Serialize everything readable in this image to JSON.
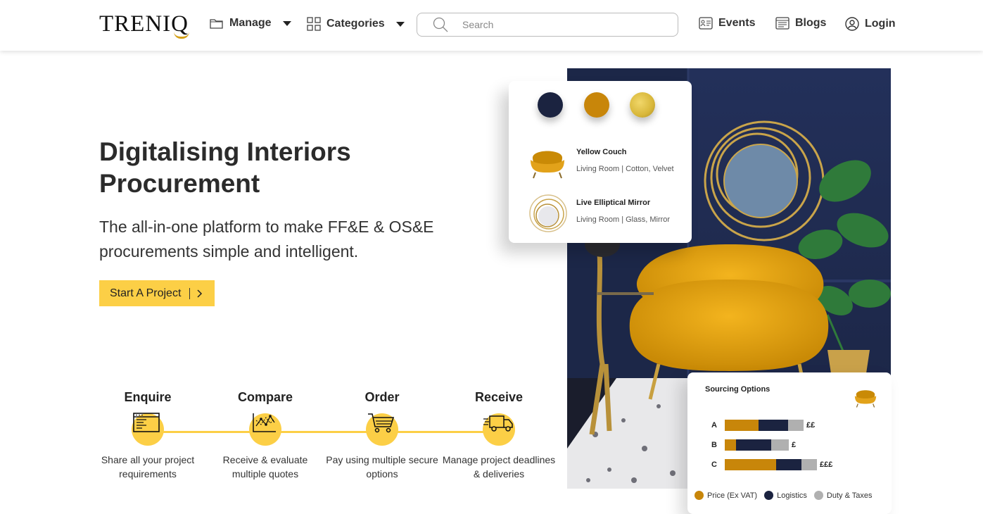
{
  "nav": {
    "logo": "TRENIQ",
    "manage": "Manage",
    "categories": "Categories",
    "search_placeholder": "Search",
    "events": "Events",
    "blogs": "Blogs",
    "login": "Login"
  },
  "hero": {
    "title": "Digitalising Interiors Procurement",
    "subtitle": "The all-in-one platform to make FF&E & OS&E procurements simple and intelligent.",
    "cta": "Start A Project"
  },
  "steps": [
    {
      "title": "Enquire",
      "desc": "Share all your project requirements"
    },
    {
      "title": "Compare",
      "desc": "Receive & evaluate multiple quotes"
    },
    {
      "title": "Order",
      "desc": "Pay using multiple secure options"
    },
    {
      "title": "Receive",
      "desc": "Manage project deadlines & deliveries"
    }
  ],
  "colors": {
    "accent": "#fccf46",
    "navy": "#1b2340",
    "gold": "#c8860a",
    "grey": "#b0b0b0",
    "swatches": [
      "#1b2340",
      "#c8860a",
      "#d8b73a"
    ]
  },
  "product_card": {
    "items": [
      {
        "name": "Yellow Couch",
        "desc": "Living Room | Cotton, Velvet"
      },
      {
        "name": "Live Elliptical Mirror",
        "desc": "Living Room | Glass, Mirror"
      }
    ]
  },
  "sourcing": {
    "title": "Sourcing Options",
    "rows": [
      {
        "label": "A",
        "price": 48,
        "logistics": 42,
        "duty": 22,
        "value": "££"
      },
      {
        "label": "B",
        "price": 16,
        "logistics": 50,
        "duty": 25,
        "value": "£"
      },
      {
        "label": "C",
        "price": 73,
        "logistics": 36,
        "duty": 22,
        "value": "£££"
      }
    ],
    "legend": [
      "Price (Ex VAT)",
      "Logistics",
      "Duty & Taxes"
    ]
  }
}
